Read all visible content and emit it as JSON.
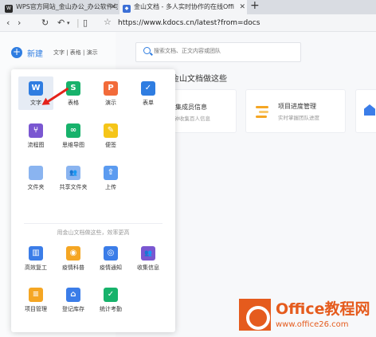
{
  "browser": {
    "tabs": [
      {
        "title": "WPS官方网站_金山办公_办公软件与",
        "icon": "wps-icon",
        "color": "#2a2a2a"
      },
      {
        "title": "金山文档 - 多人实时协作的在线Offi",
        "icon": "kdocs-icon",
        "color": "#3b6fd6"
      }
    ],
    "new_tab": "+",
    "url": "https://www.kdocs.cn/latest?from=docs"
  },
  "sidebar": {
    "new_label": "新建",
    "new_sub": "文字 | 表格 | 演示"
  },
  "search": {
    "placeholder": "搜索文档、正文内容或团队"
  },
  "main": {
    "heading": "用金山文档做这些",
    "cards": [
      {
        "title": "收集成员信息",
        "sub": "分钟收集百人信息"
      },
      {
        "title": "项目进度管理",
        "sub": "实时掌握团队进度"
      }
    ]
  },
  "menu": {
    "items": [
      {
        "label": "文字",
        "glyph": "W",
        "color": "#2f7de1",
        "icon": "doc-icon"
      },
      {
        "label": "表格",
        "glyph": "S",
        "color": "#17b26b",
        "icon": "sheet-icon"
      },
      {
        "label": "演示",
        "glyph": "P",
        "color": "#f26b3a",
        "icon": "slides-icon"
      },
      {
        "label": "表单",
        "glyph": "✓",
        "color": "#2f7de1",
        "icon": "form-icon"
      },
      {
        "label": "流程图",
        "glyph": "⑂",
        "color": "#7a57d1",
        "icon": "flowchart-icon"
      },
      {
        "label": "思维导图",
        "glyph": "∞",
        "color": "#17b26b",
        "icon": "mindmap-icon"
      },
      {
        "label": "便签",
        "glyph": "✎",
        "color": "#f5c518",
        "icon": "note-icon"
      },
      {
        "label": "文件夹",
        "glyph": "",
        "color": "#8ab4f0",
        "icon": "folder-icon"
      },
      {
        "label": "共享文件夹",
        "glyph": "👥",
        "color": "#8ab4f0",
        "icon": "shared-folder-icon"
      },
      {
        "label": "上传",
        "glyph": "⇧",
        "color": "#5b9bf0",
        "icon": "upload-icon"
      }
    ],
    "promo": "用金山文档做这些，效率更高",
    "templates": [
      {
        "label": "高效复工",
        "glyph": "▥",
        "color": "#3b7de8",
        "icon": "building-icon"
      },
      {
        "label": "疫情科普",
        "glyph": "◉",
        "color": "#f5a623",
        "icon": "science-icon"
      },
      {
        "label": "疫情通知",
        "glyph": "◎",
        "color": "#3b7de8",
        "icon": "notice-icon"
      },
      {
        "label": "收集信息",
        "glyph": "👥",
        "color": "#7a57d1",
        "icon": "collect-icon"
      },
      {
        "label": "项目管理",
        "glyph": "≡",
        "color": "#f5a623",
        "icon": "project-icon"
      },
      {
        "label": "登记库存",
        "glyph": "⌂",
        "color": "#3b7de8",
        "icon": "inventory-icon"
      },
      {
        "label": "统计考勤",
        "glyph": "✓",
        "color": "#17b26b",
        "icon": "attendance-icon"
      }
    ]
  },
  "watermark": {
    "brand": "Office教程网",
    "site": "www.office26.com"
  }
}
